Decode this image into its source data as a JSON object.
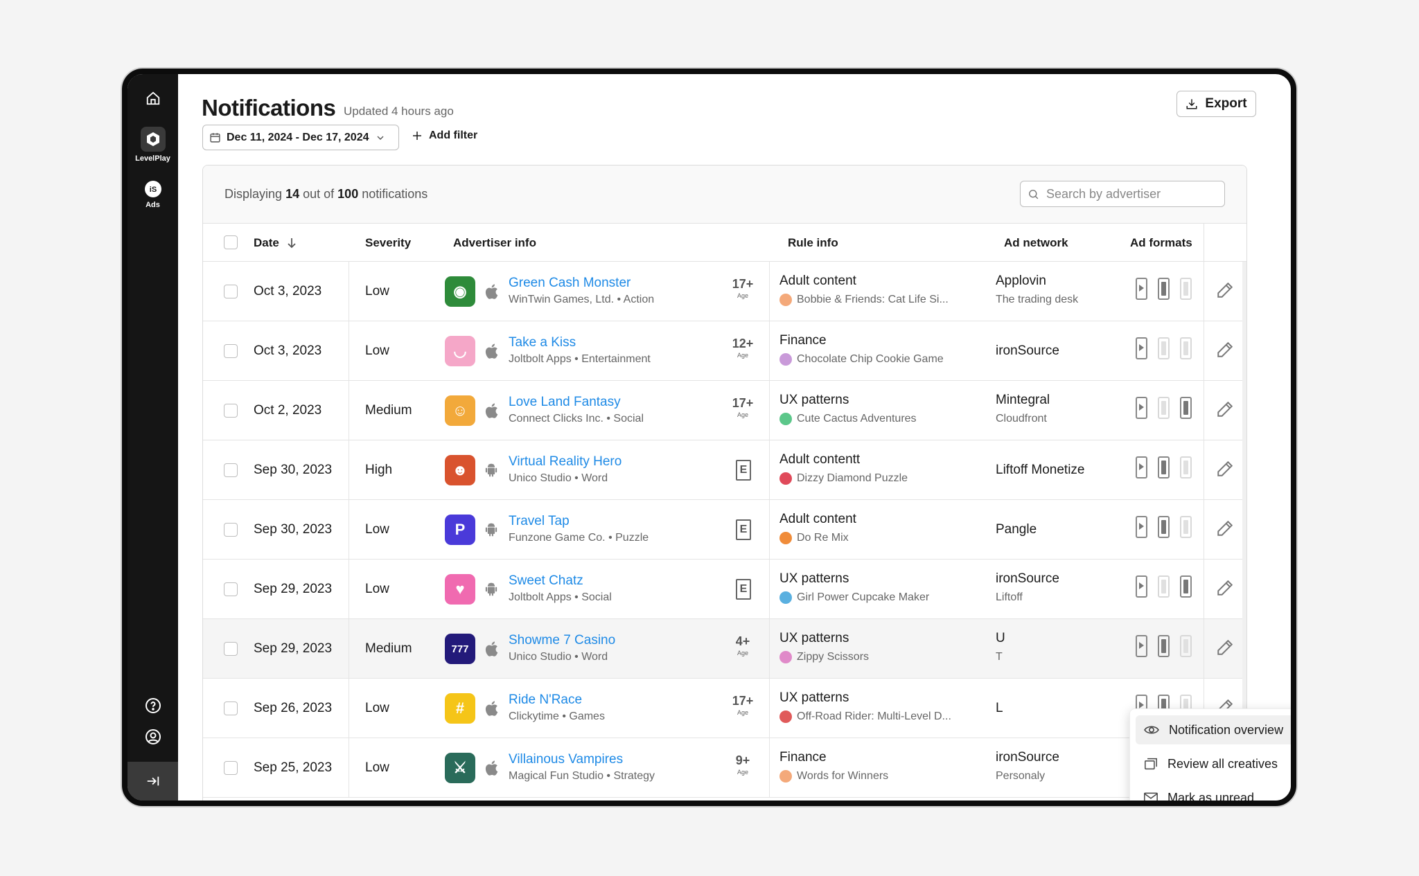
{
  "sidebar": {
    "items": [
      {
        "label": "",
        "icon": "home-icon"
      },
      {
        "label": "LevelPlay",
        "icon": "levelplay-icon"
      },
      {
        "label": "Ads",
        "icon": "ads-icon"
      }
    ],
    "bottom_icons": [
      "help-icon",
      "account-icon",
      "collapse-icon"
    ]
  },
  "header": {
    "title": "Notifications",
    "subtitle": "Updated 4 hours ago",
    "export_label": "Export",
    "date_range": "Dec 11, 2024 - Dec 17, 2024",
    "add_filter_label": "Add filter"
  },
  "table_header": {
    "displaying_prefix": "Displaying",
    "shown": "14",
    "out_of": "out of",
    "total": "100",
    "suffix": "notifications",
    "search_placeholder": "Search by advertiser"
  },
  "columns": {
    "date": "Date",
    "severity": "Severity",
    "advertiser": "Advertiser info",
    "rule": "Rule info",
    "network": "Ad network",
    "formats": "Ad formats"
  },
  "rows": [
    {
      "date": "Oct 3, 2023",
      "severity": "Low",
      "app": "Green Cash Monster",
      "publisher": "WinTwin Games, Ltd. • Action",
      "platform": "apple",
      "age": "17+",
      "age_label": "Age",
      "rule": "Adult content",
      "rule_app": "Bobbie & Friends: Cat Life Si...",
      "network": "Applovin",
      "network_sub": "The trading desk",
      "icon_color": "#2e8b3a",
      "icon_glyph": "◉",
      "dot": "#f4a97a",
      "formats": [
        true,
        true,
        false
      ]
    },
    {
      "date": "Oct 3, 2023",
      "severity": "Low",
      "app": "Take a Kiss",
      "publisher": "Joltbolt Apps • Entertainment",
      "platform": "apple",
      "age": "12+",
      "age_label": "Age",
      "rule": "Finance",
      "rule_app": "Chocolate Chip Cookie Game",
      "network": "ironSource",
      "network_sub": "",
      "icon_color": "#f5a7c8",
      "icon_glyph": "◡",
      "dot": "#c99ad9",
      "formats": [
        true,
        false,
        false
      ]
    },
    {
      "date": "Oct 2, 2023",
      "severity": "Medium",
      "app": "Love Land Fantasy",
      "publisher": "Connect Clicks Inc. • Social",
      "platform": "apple",
      "age": "17+",
      "age_label": "Age",
      "rule": "UX patterns",
      "rule_app": "Cute Cactus Adventures",
      "network": "Mintegral",
      "network_sub": "Cloudfront",
      "icon_color": "#f2a93b",
      "icon_glyph": "☺",
      "dot": "#5cc78a",
      "formats": [
        true,
        false,
        true
      ]
    },
    {
      "date": "Sep 30, 2023",
      "severity": "High",
      "app": "Virtual Reality Hero",
      "publisher": "Unico Studio • Word",
      "platform": "android",
      "age": "E",
      "age_label": "",
      "rule": "Adult contentt",
      "rule_app": "Dizzy Diamond Puzzle",
      "network": "Liftoff Monetize",
      "network_sub": "",
      "icon_color": "#d9532e",
      "icon_glyph": "☻",
      "dot": "#e04a5a",
      "formats": [
        true,
        true,
        false
      ]
    },
    {
      "date": "Sep 30, 2023",
      "severity": "Low",
      "app": "Travel Tap",
      "publisher": "Funzone Game Co. • Puzzle",
      "platform": "android",
      "age": "E",
      "age_label": "",
      "rule": "Adult content",
      "rule_app": "Do Re Mix",
      "network": "Pangle",
      "network_sub": "",
      "icon_color": "#4a3ad9",
      "icon_glyph": "P",
      "dot": "#f08c3a",
      "formats": [
        true,
        true,
        false
      ]
    },
    {
      "date": "Sep 29, 2023",
      "severity": "Low",
      "app": "Sweet Chatz",
      "publisher": "Joltbolt Apps • Social",
      "platform": "android",
      "age": "E",
      "age_label": "",
      "rule": "UX patterns",
      "rule_app": "Girl Power Cupcake Maker",
      "network": "ironSource",
      "network_sub": "Liftoff",
      "icon_color": "#f06ab0",
      "icon_glyph": "♥",
      "dot": "#5ab0e0",
      "formats": [
        true,
        false,
        true
      ]
    },
    {
      "date": "Sep 29, 2023",
      "severity": "Medium",
      "app": "Showme 7 Casino",
      "publisher": "Unico Studio • Word",
      "platform": "apple",
      "age": "4+",
      "age_label": "Age",
      "rule": "UX patterns",
      "rule_app": "Zippy Scissors",
      "network": "U",
      "network_sub": "T",
      "icon_color": "#231a7a",
      "icon_glyph": "777",
      "dot": "#e08ac9",
      "formats": [
        true,
        true,
        false
      ]
    },
    {
      "date": "Sep 26, 2023",
      "severity": "Low",
      "app": "Ride N'Race",
      "publisher": "Clickytime • Games",
      "platform": "apple",
      "age": "17+",
      "age_label": "Age",
      "rule": "UX patterns",
      "rule_app": "Off-Road Rider: Multi-Level D...",
      "network": "L",
      "network_sub": "",
      "icon_color": "#f5c518",
      "icon_glyph": "#",
      "dot": "#e05a5a",
      "formats": [
        true,
        true,
        false
      ]
    },
    {
      "date": "Sep 25, 2023",
      "severity": "Low",
      "app": "Villainous Vampires",
      "publisher": "Magical Fun Studio • Strategy",
      "platform": "apple",
      "age": "9+",
      "age_label": "Age",
      "rule": "Finance",
      "rule_app": "Words for Winners",
      "network": "ironSource",
      "network_sub": "Personaly",
      "icon_color": "#2a6b5a",
      "icon_glyph": "⚔",
      "dot": "#f4a97a",
      "formats": [
        true,
        true,
        false
      ]
    }
  ],
  "context_menu": {
    "items": [
      {
        "label": "Notification overview",
        "icon": "eye-icon"
      },
      {
        "label": "Review all creatives",
        "icon": "copy-icon"
      },
      {
        "label": "Mark as unread",
        "icon": "mail-icon"
      }
    ]
  }
}
